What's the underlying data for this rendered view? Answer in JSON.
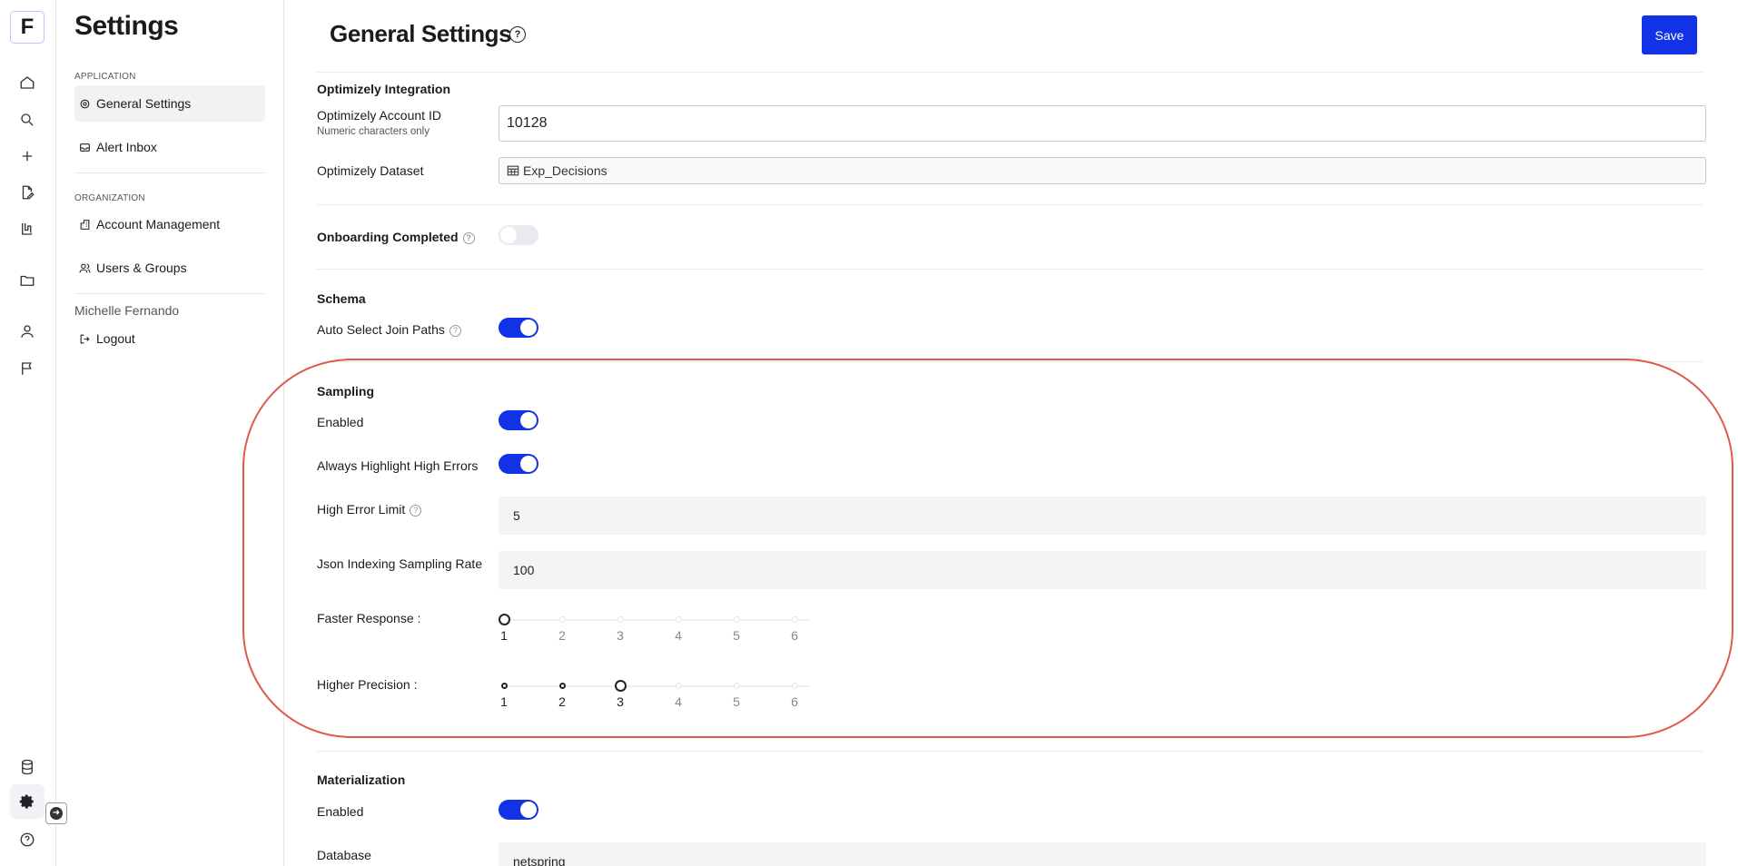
{
  "rail": {
    "logo": "F",
    "icons": [
      "home-icon",
      "search-icon",
      "plus-icon",
      "document-edit-icon",
      "flask-icon",
      "folder-icon",
      "user-icon",
      "flag-icon",
      "database-icon",
      "gear-icon",
      "help-icon",
      "arrow-right-icon"
    ]
  },
  "sidebar": {
    "title": "Settings",
    "application_label": "APPLICATION",
    "organization_label": "ORGANIZATION",
    "items": [
      {
        "label": "General Settings",
        "icon": "gear-icon"
      },
      {
        "label": "Alert Inbox",
        "icon": "inbox-icon"
      },
      {
        "label": "Account Management",
        "icon": "building-icon"
      },
      {
        "label": "Users & Groups",
        "icon": "users-icon"
      }
    ],
    "user_name": "Michelle Fernando",
    "logout_label": "Logout"
  },
  "header": {
    "title": "General Settings",
    "help": "?",
    "save_label": "Save"
  },
  "optimizely": {
    "section_title": "Optimizely Integration",
    "account_id_label": "Optimizely Account ID",
    "account_id_sub": "Numeric characters only",
    "account_id_value": "10128",
    "dataset_label": "Optimizely Dataset",
    "dataset_value": "Exp_Decisions"
  },
  "onboarding": {
    "label": "Onboarding Completed",
    "enabled": false
  },
  "schema": {
    "section_title": "Schema",
    "auto_select_label": "Auto Select Join Paths",
    "auto_select_enabled": true
  },
  "sampling": {
    "section_title": "Sampling",
    "enabled_label": "Enabled",
    "enabled": true,
    "highlight_label": "Always Highlight High Errors",
    "highlight_enabled": true,
    "high_error_label": "High Error Limit",
    "high_error_value": "5",
    "json_rate_label": "Json Indexing Sampling Rate",
    "json_rate_value": "100",
    "faster_label": "Faster Response :",
    "faster_value": 1,
    "precision_label": "Higher Precision :",
    "precision_value": 3,
    "slider_ticks": [
      "1",
      "2",
      "3",
      "4",
      "5",
      "6"
    ]
  },
  "materialization": {
    "section_title": "Materialization",
    "enabled_label": "Enabled",
    "enabled": true,
    "database_label": "Database",
    "database_value": "netspring"
  },
  "colors": {
    "accent": "#1132e6",
    "highlight_ring": "#e05a48"
  }
}
